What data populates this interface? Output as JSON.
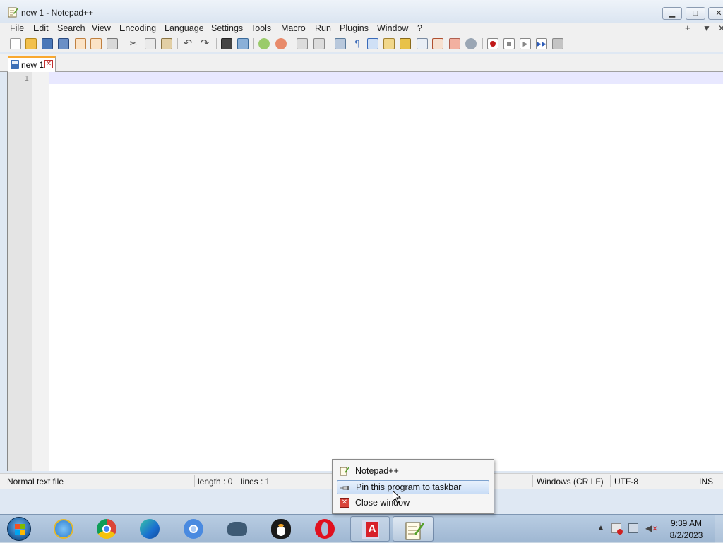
{
  "window": {
    "title": "new 1 - Notepad++"
  },
  "caption_buttons": {
    "minimize": "▁",
    "maximize": "□",
    "close": "✕"
  },
  "menu": {
    "items": [
      "File",
      "Edit",
      "Search",
      "View",
      "Encoding",
      "Language",
      "Settings",
      "Tools",
      "Macro",
      "Run",
      "Plugins",
      "Window",
      "?"
    ],
    "right": [
      "+",
      "▼",
      "✕"
    ]
  },
  "toolbar": {
    "icons": [
      "new-file-icon",
      "open-file-icon",
      "save-icon",
      "save-all-icon",
      "close-icon",
      "close-all-icon",
      "print-icon",
      "cut-icon",
      "copy-icon",
      "paste-icon",
      "undo-icon",
      "redo-icon",
      "find-icon",
      "replace-icon",
      "zoom-in-icon",
      "zoom-out-icon",
      "sync-vertical-icon",
      "sync-horizontal-icon",
      "word-wrap-icon",
      "show-all-characters-icon",
      "indent-guide-icon",
      "user-defined-language-icon",
      "document-map-icon",
      "document-list-icon",
      "function-list-icon",
      "folder-as-workspace-icon",
      "monitoring-icon",
      "record-macro-icon",
      "stop-recording-icon",
      "play-macro-icon",
      "run-macro-multiple-icon",
      "save-macro-icon"
    ]
  },
  "tabs": [
    {
      "label": "new 1",
      "close": "✕"
    }
  ],
  "editor": {
    "line_numbers": [
      "1"
    ]
  },
  "statusbar": {
    "file_type": "Normal text file",
    "length": "length : 0",
    "lines": "lines : 1",
    "eol": "Windows (CR LF)",
    "encoding": "UTF-8",
    "mode": "INS"
  },
  "jumplist": {
    "items": [
      {
        "label": "Notepad++",
        "icon": "notepadpp-icon"
      },
      {
        "label": "Pin this program to taskbar",
        "icon": "pin-icon"
      },
      {
        "label": "Close window",
        "icon": "close-window-icon"
      }
    ]
  },
  "taskbar": {
    "apps": [
      "internet-explorer-icon",
      "chrome-icon",
      "edge-icon",
      "chromium-icon",
      "reader-icon",
      "penguin-icon",
      "opera-icon",
      "acrobat-icon",
      "notepadpp-icon"
    ],
    "clock": {
      "time": "9:39 AM",
      "date": "8/2/2023"
    }
  },
  "colors": {
    "current_line": "#e8e8ff",
    "tab_accent": "#f9a82f",
    "taskbar": "#a9c0da"
  }
}
